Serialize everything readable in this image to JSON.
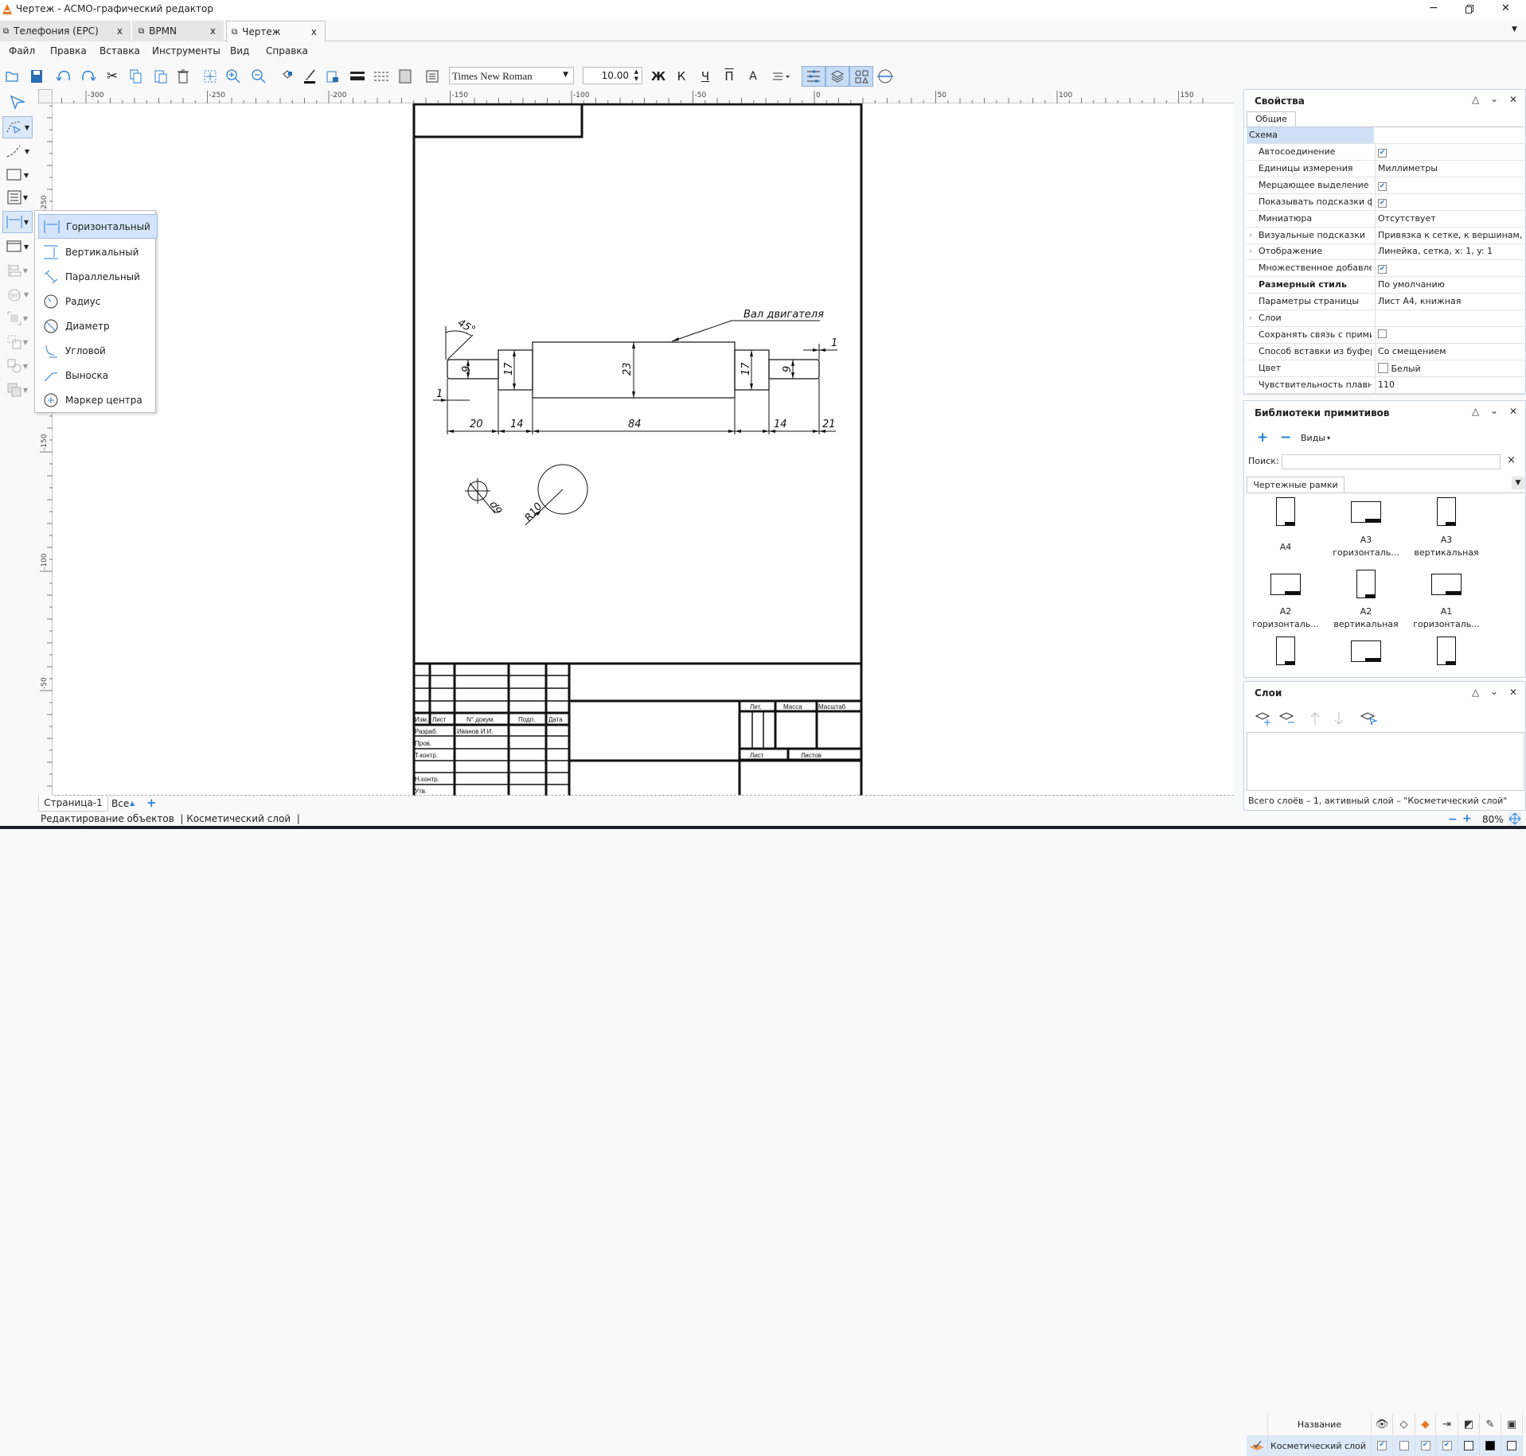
{
  "window": {
    "title": "Чертеж - АСМО-графический редактор",
    "app_icon": "asmo-logo-icon",
    "accent": "#e8771e"
  },
  "tabs": [
    {
      "label": "Телефония (EPC)",
      "active": false
    },
    {
      "label": "BPMN",
      "active": false
    },
    {
      "label": "Чертеж",
      "active": true
    }
  ],
  "tab_close": "x",
  "menu": [
    "Файл",
    "Правка",
    "Вставка",
    "Инструменты",
    "Вид",
    "Справка"
  ],
  "toolbar": {
    "font": "Times New Roman",
    "size": "10.00",
    "bold": "Ж",
    "italic": "К",
    "underline": "Ч",
    "overline": "П",
    "font_color": "A",
    "icons": [
      "open-icon",
      "save-icon",
      "undo-icon",
      "redo-icon",
      "cut-icon",
      "copy-icon",
      "paste-icon",
      "delete-icon",
      "fit-icon",
      "zoom-in-icon",
      "zoom-out-icon",
      "fill-icon",
      "line-color-icon",
      "text-color-icon",
      "line-width-icon",
      "line-style-icon",
      "fill-color-icon",
      "text-style-icon",
      "align-icon",
      "snap-grid-icon",
      "layers-icon",
      "primitives-icon",
      "crosshair-icon"
    ]
  },
  "dimension_menu": {
    "items": [
      "Горизонтальный",
      "Вертикальный",
      "Параллельный",
      "Радиус",
      "Диаметр",
      "Угловой",
      "Выноска",
      "Маркер центра"
    ],
    "selected": "Горизонтальный"
  },
  "ruler": {
    "top_labels": [
      "-300",
      "-250",
      "-200",
      "-150",
      "-100",
      "-50",
      "0",
      "50",
      "100",
      "150"
    ],
    "left_labels": [
      "-250",
      "-200",
      "-150",
      "-100",
      "-50"
    ]
  },
  "drawing": {
    "leader_text": "Вал двигателя",
    "dims": {
      "l1": "20",
      "l2": "14",
      "l3": "84",
      "l4": "14",
      "l5": "21",
      "d_small_left": "9",
      "d_mid_left": "17",
      "d_big": "23",
      "d_mid_right": "17",
      "d_small_right": "9",
      "chamfer_left": "1",
      "chamfer_right": "1",
      "angle": "45°",
      "diameter": "d9",
      "radius": "R10"
    },
    "title_block": {
      "izm": "Изм.",
      "list": "Лист",
      "doc": "N° докум.",
      "podp": "Подп.",
      "data": "Дата",
      "razrab": "Разраб.",
      "author": "Иванов И.И.",
      "prov": "Пров.",
      "tkontr": "Т.контр.",
      "nkontr": "Н.контр.",
      "utv": "Утв.",
      "lit": "Лит.",
      "massa": "Масса",
      "masshtab": "Масштаб",
      "sheet": "Лист",
      "sheets": "Листов"
    }
  },
  "page_tabs": {
    "page": "Страница-1",
    "filter": "Все",
    "add": "+"
  },
  "status": "Редактирование объектов  | Косметический слой  |",
  "properties": {
    "title": "Свойства",
    "tab": "Общие",
    "group": "Схема",
    "rows": [
      {
        "key": "Автосоединение",
        "value": "",
        "checked": true
      },
      {
        "key": "Единицы измерения",
        "value": "Миллиметры"
      },
      {
        "key": "Мерцающее выделение",
        "value": "",
        "checked": true
      },
      {
        "key": "Показывать подсказки ф",
        "value": "",
        "checked": true
      },
      {
        "key": "Миниатюра",
        "value": "Отсутствует"
      },
      {
        "key": "Визуальные подсказки",
        "value": "Привязка к сетке, к вершинам, к",
        "expandable": true
      },
      {
        "key": "Отображение",
        "value": "Линейка, сетка, x: 1, y: 1",
        "expandable": true
      },
      {
        "key": "Множественное добавле",
        "value": "",
        "checked": true
      },
      {
        "key": "Размерный стиль",
        "value": "По умолчанию",
        "bold": true
      },
      {
        "key": "Параметры страницы",
        "value": "Лист А4, книжная"
      },
      {
        "key": "Слои",
        "value": "",
        "expandable": true
      },
      {
        "key": "Сохранять связь с прими",
        "value": "",
        "checked": false
      },
      {
        "key": "Способ вставки из буфер",
        "value": "Со смещением"
      },
      {
        "key": "Цвет",
        "value": "Белый",
        "color": "#ffffff"
      },
      {
        "key": "Чувствительность плавн",
        "value": "110"
      }
    ]
  },
  "library": {
    "title": "Библиотеки примитивов",
    "add": "+",
    "remove": "−",
    "views": "Виды",
    "search_label": "Поиск:",
    "search_value": "",
    "search_clear": "×",
    "tab": "Чертежные рамки",
    "items": [
      {
        "l1": "А4",
        "l2": ""
      },
      {
        "l1": "А3",
        "l2": "горизонталь..."
      },
      {
        "l1": "А3",
        "l2": "вертикальная"
      },
      {
        "l1": "А2",
        "l2": "горизонталь..."
      },
      {
        "l1": "А2",
        "l2": "вертикальная"
      },
      {
        "l1": "А1",
        "l2": "горизонталь..."
      }
    ]
  },
  "layers": {
    "title": "Слои",
    "column_name": "Название",
    "rows": [
      {
        "name": "Косметический слой",
        "visible": true,
        "locked": false,
        "active": true,
        "printable": true
      }
    ],
    "footer": "Всего слоёв – 1, активный слой – \"Косметический слой\""
  },
  "zoom": {
    "minus": "−",
    "plus": "+",
    "value": "80%"
  },
  "panel_controls": {
    "up": "△",
    "down": "⌄",
    "close": "✕"
  }
}
